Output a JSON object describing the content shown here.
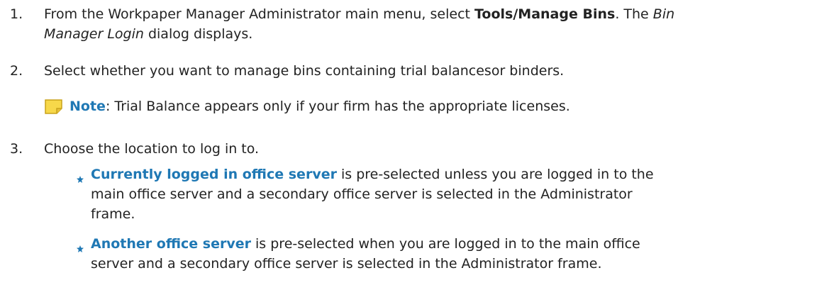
{
  "steps": [
    {
      "number": "1.",
      "line1_a": "From the Workpaper Manager Administrator main menu, select ",
      "line1_b": "Tools/Manage Bins",
      "line1_c": ". The ",
      "line1_d": "Bin",
      "line2_a": "Manager Login",
      "line2_b": " dialog displays."
    },
    {
      "number": "2.",
      "text": "Select whether you want to manage bins containing trial balancesor binders."
    },
    {
      "number": "3.",
      "text": "Choose the location to log in to."
    }
  ],
  "note": {
    "icon": "sticky-note-icon",
    "label": "Note",
    "text": ": Trial Balance appears only if your firm has the appropriate licenses."
  },
  "bullets": [
    {
      "icon": "bullet-star-icon",
      "term": "Currently logged in office server",
      "line1": " is pre-selected unless you are logged in to the",
      "line2": "main office server and a secondary office server is selected in the Administrator",
      "line3": "frame."
    },
    {
      "icon": "bullet-star-icon",
      "term": "Another office server",
      "line1": " is pre-selected when you are logged in to the main office",
      "line2": "server and a secondary office server is selected in the Administrator frame."
    }
  ],
  "colors": {
    "link_blue": "#1f78b4",
    "note_yellow": "#f7d84a"
  }
}
